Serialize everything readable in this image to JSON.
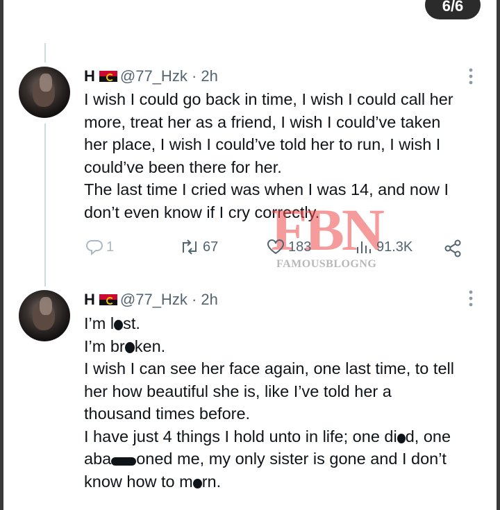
{
  "media_counter": "6/6",
  "tweets": [
    {
      "name": "H",
      "handle": "@77_Hzk",
      "separator": "·",
      "time": "2h",
      "lines": [
        "I wish I could go back in time, I wish I could call her",
        "more, treat her as a friend, I wish I could’ve taken",
        "her place, I wish I could’ve told her to run, I wish I",
        "could’ve been there for her.",
        "The last time I cried was when I was 14, and now I",
        "don’t even know if I cry correctly."
      ],
      "replies": "1",
      "retweets": "67",
      "likes": "183",
      "views": "91.3K"
    },
    {
      "name": "H",
      "handle": "@77_Hzk",
      "separator": "·",
      "time": "2h",
      "line1_a": "I’m l",
      "line1_b": "st.",
      "line2_a": "I’m br",
      "line2_b": "ken.",
      "lines": [
        "I wish I can see her face again, one last time, to tell",
        "her how beautiful she is, like I’ve told her a",
        "thousand times before."
      ],
      "line6_a": "I have just 4 things I hold unto in life; one di",
      "line6_b": "d, one",
      "line7_a": "aba",
      "line7_b": "oned me, my only sister is gone and I don’t",
      "line8_a": "know how to m",
      "line8_b": "rn."
    }
  ],
  "watermark": {
    "letters": "FBN",
    "subtitle": "FAMOUSBLOGNG"
  }
}
